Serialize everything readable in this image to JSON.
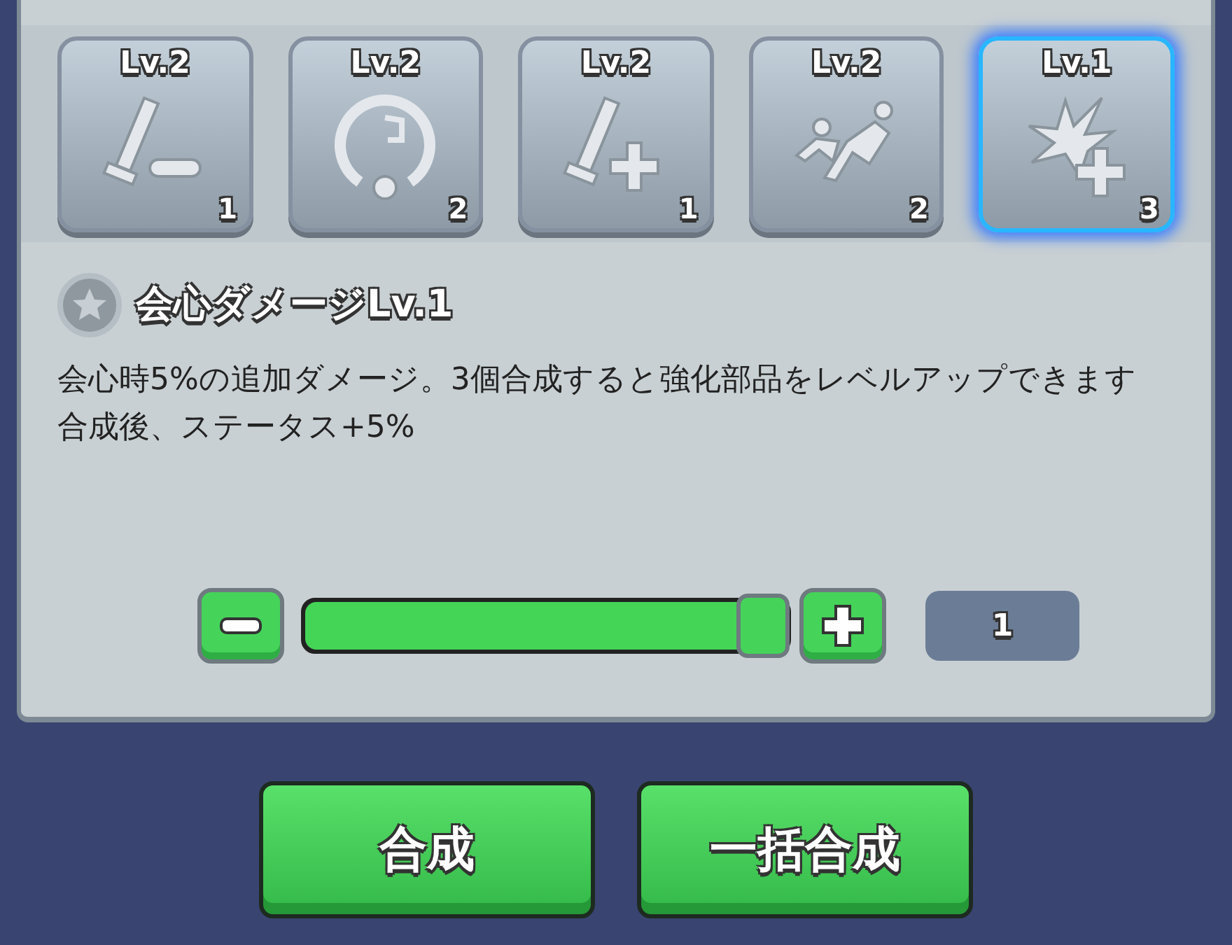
{
  "items": [
    {
      "kind": "tube-minus",
      "level": "Lv.2",
      "count": "1",
      "selected": false
    },
    {
      "kind": "gauge",
      "level": "Lv.2",
      "count": "2",
      "selected": false
    },
    {
      "kind": "tube-plus",
      "level": "Lv.2",
      "count": "1",
      "selected": false
    },
    {
      "kind": "runners",
      "level": "Lv.2",
      "count": "2",
      "selected": false
    },
    {
      "kind": "burst-plus",
      "level": "Lv.1",
      "count": "3",
      "selected": true
    }
  ],
  "detail": {
    "title": "会心ダメージLv.1",
    "description": "会心時5%の追加ダメージ。3個合成すると強化部品をレベルアップできます合成後、ステータス+5%"
  },
  "quantity": {
    "level": 1,
    "value": "1"
  },
  "buttons": [
    "合成",
    "一括合成"
  ]
}
